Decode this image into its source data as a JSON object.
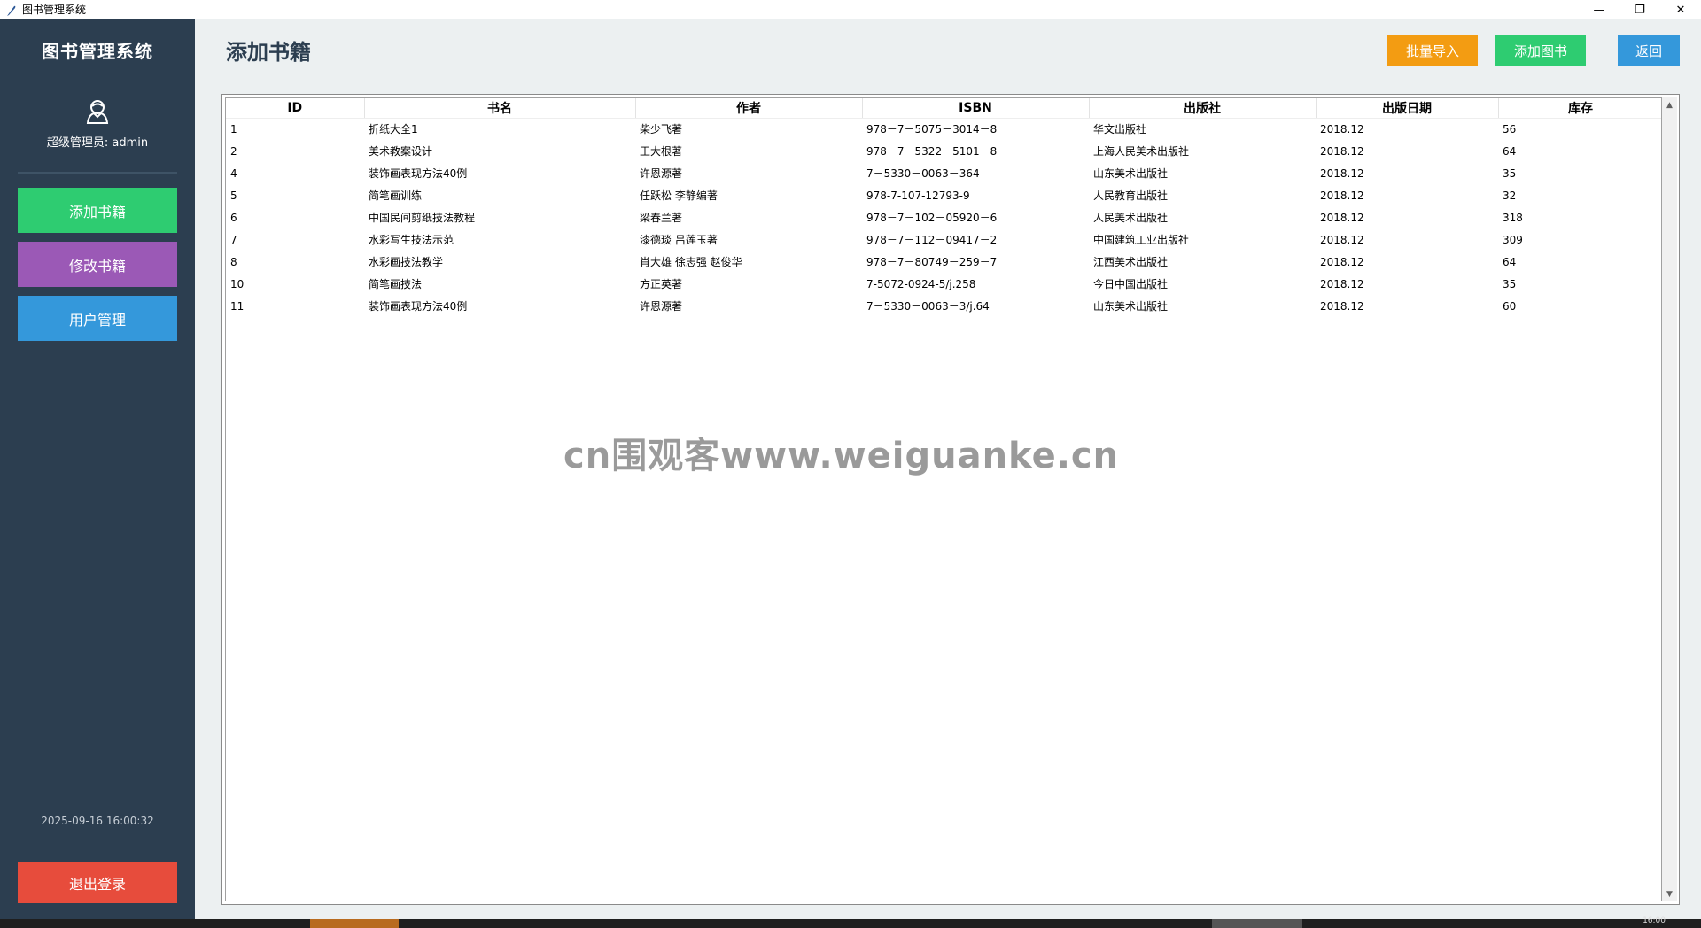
{
  "window": {
    "title": "图书管理系统",
    "controls": {
      "minimize": "—",
      "restore": "❐",
      "close": "✕"
    }
  },
  "sidebar": {
    "app_title": "图书管理系统",
    "user_label": "超级管理员: admin",
    "nav": [
      {
        "label": "添加书籍",
        "color": "#2ecc71"
      },
      {
        "label": "修改书籍",
        "color": "#9b59b6"
      },
      {
        "label": "用户管理",
        "color": "#3498db"
      }
    ],
    "datetime": "2025-09-16 16:00:32",
    "logout_label": "退出登录"
  },
  "main": {
    "page_title": "添加书籍",
    "actions": {
      "batch_import": "批量导入",
      "add_book": "添加图书",
      "back": "返回"
    },
    "table": {
      "columns": [
        "ID",
        "书名",
        "作者",
        "ISBN",
        "出版社",
        "出版日期",
        "库存"
      ],
      "rows": [
        [
          "1",
          "折纸大全1",
          "柴少飞著",
          "978－7－5075－3014－8",
          "华文出版社",
          "2018.12",
          "56"
        ],
        [
          "2",
          "美术教案设计",
          "王大根著",
          "978－7－5322－5101－8",
          "上海人民美术出版社",
          "2018.12",
          "64"
        ],
        [
          "4",
          "装饰画表现方法40例",
          "许恩源著",
          "7－5330－0063－364",
          "山东美术出版社",
          "2018.12",
          "35"
        ],
        [
          "5",
          "简笔画训练",
          "任跃松 李静编著",
          "978-7-107-12793-9",
          "人民教育出版社",
          "2018.12",
          "32"
        ],
        [
          "6",
          "中国民间剪纸技法教程",
          "梁春兰著",
          "978－7－102－05920－6",
          "人民美术出版社",
          "2018.12",
          "318"
        ],
        [
          "7",
          "水彩写生技法示范",
          "漆德琰 吕莲玉著",
          "978－7－112－09417－2",
          "中国建筑工业出版社",
          "2018.12",
          "309"
        ],
        [
          "8",
          "水彩画技法教学",
          "肖大雄 徐志强 赵俊华",
          "978－7－80749－259－7",
          "江西美术出版社",
          "2018.12",
          "64"
        ],
        [
          "10",
          "简笔画技法",
          "方正英著",
          "7-5072-0924-5/j.258",
          "今日中国出版社",
          "2018.12",
          "35"
        ],
        [
          "11",
          "装饰画表现方法40例",
          "许恩源著",
          "7－5330－0063－3/j.64",
          "山东美术出版社",
          "2018.12",
          "60"
        ]
      ]
    },
    "watermark": "cn围观客www.weiguanke.cn"
  },
  "taskbar": {
    "clock": "16:00"
  }
}
